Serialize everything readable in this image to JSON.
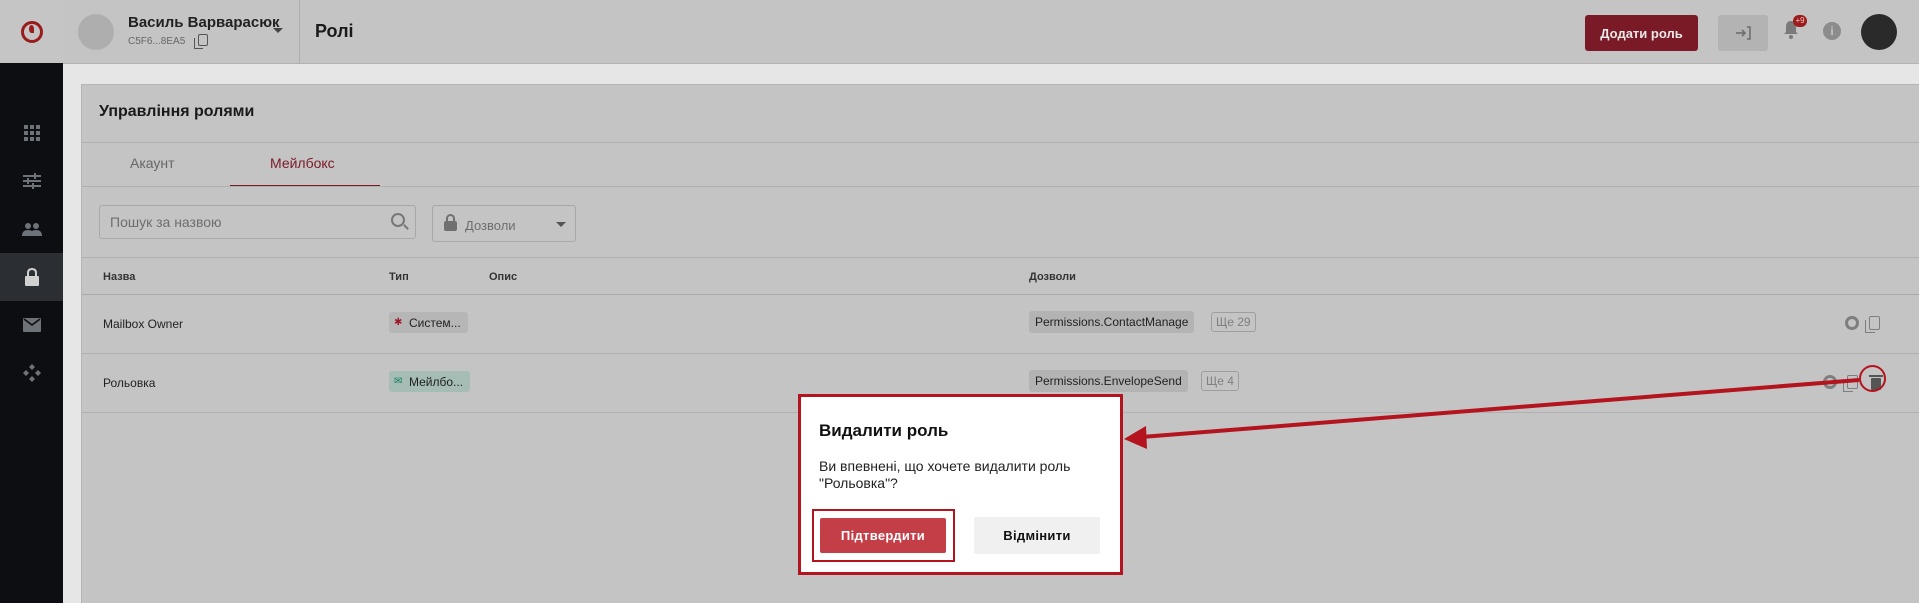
{
  "sidebar": {
    "logo": "vodafone-logo",
    "items": [
      {
        "icon": "apps-icon"
      },
      {
        "icon": "sliders-icon"
      },
      {
        "icon": "users-icon"
      },
      {
        "icon": "lock-icon",
        "active": true
      },
      {
        "icon": "mail-icon"
      },
      {
        "icon": "integrations-icon"
      }
    ]
  },
  "header": {
    "user_name": "Василь Варварасюк",
    "user_id": "C5F6...8EA5",
    "page_title": "Ролі",
    "add_role_label": "Додати роль",
    "notifications_badge": "+9"
  },
  "main": {
    "title": "Управління ролями",
    "tabs": [
      {
        "label": "Акаунт",
        "active": false
      },
      {
        "label": "Мейлбокс",
        "active": true
      }
    ],
    "search": {
      "placeholder": "Пошук за назвою"
    },
    "permissions_filter": {
      "label": "Дозволи"
    },
    "table": {
      "headers": {
        "name": "Назва",
        "type": "Тип",
        "description": "Опис",
        "permissions": "Дозволи"
      },
      "rows": [
        {
          "name": "Mailbox Owner",
          "type": "Систем...",
          "type_icon": "gear-icon",
          "description": "",
          "permission": "Permissions.ContactManage",
          "more": "Ще 29"
        },
        {
          "name": "Рольовка",
          "type": "Мейлбо...",
          "type_icon": "mail-icon",
          "description": "",
          "permission": "Permissions.EnvelopeSend",
          "more": "Ще 4"
        }
      ]
    }
  },
  "modal": {
    "title": "Видалити роль",
    "text": "Ви впевнені, що хочете видалити роль \"Рольовка\"?",
    "confirm_label": "Підтвердити",
    "cancel_label": "Відмінити"
  },
  "colors": {
    "brand": "#7a1a26",
    "annotation": "#b3141d",
    "confirm": "#c43e47"
  }
}
